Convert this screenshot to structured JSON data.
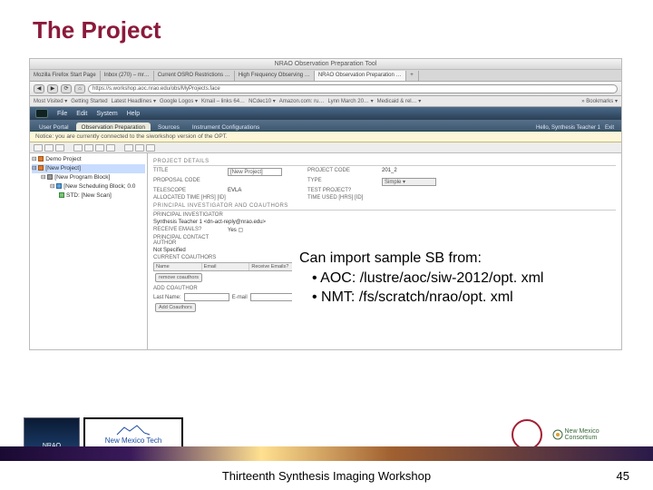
{
  "slide": {
    "title": "The Project",
    "footer_text": "Thirteenth Synthesis Imaging Workshop",
    "page_number": "45"
  },
  "overlay": {
    "heading": "Can import sample SB from:",
    "items": [
      "AOC: /lustre/aoc/siw-2012/opt. xml",
      "NMT: /fs/scratch/nrao/opt. xml"
    ]
  },
  "browser": {
    "window_title": "NRAO Observation Preparation Tool",
    "tabs": [
      "Mozilla Firefox Start Page",
      "Inbox (270) – mr…",
      "Current OSRO Restrictions …",
      "High Frequency Observing …",
      "NRAO Observation Preparation …",
      "+"
    ],
    "active_tab_index": 4,
    "url": "https://s.workshop.aoc.nrao.edu/obs/MyProjects.face",
    "bookmarks": [
      "Most Visited ▾",
      "Getting Started",
      "Latest Headlines ▾",
      "Google Logos ▾",
      "Kmail – links 64…",
      "NCdec10 ▾",
      "Amazon.com: ru…",
      "Lynn March 20… ▾",
      "Medicaid & rel… ▾",
      "» Bookmarks ▾"
    ]
  },
  "opt": {
    "menus": [
      "File",
      "Edit",
      "System",
      "Help"
    ],
    "tabs": [
      "User Portal",
      "Observation Preparation",
      "Sources",
      "Instrument Configurations"
    ],
    "active_tab_index": 1,
    "user_greeting": "Hello, Synthesis Teacher 1",
    "exit": "Exit",
    "notice": "Notice: you are currently connected to the siworkshop version of the OPT."
  },
  "tree": {
    "items": [
      {
        "label": "Demo Project",
        "color": "orange"
      },
      {
        "label": "[New  Project]",
        "color": "orange",
        "selected": true
      },
      {
        "label": "[New Program Block]",
        "color": "grey",
        "indent": 1
      },
      {
        "label": "[New Scheduling Block; 0.0",
        "color": "blue",
        "indent": 2
      },
      {
        "label": "STD: [New Scan]",
        "color": "green",
        "indent": 3
      }
    ]
  },
  "form": {
    "details_header": "PROJECT DETAILS",
    "rows": [
      {
        "label": "TITLE",
        "input": "[New  Project]",
        "label2": "PROJECT CODE",
        "val2": "201_2"
      },
      {
        "label": "PROPOSAL CODE",
        "val": "",
        "label2": "TYPE",
        "input2": "Simple ▾"
      },
      {
        "label": "TELESCOPE",
        "val": "EVLA",
        "label2": "TEST PROJECT?",
        "val2": ""
      },
      {
        "label": "ALLOCATED TIME [HRS] [ID]",
        "val": "",
        "label2": "TIME USED [HRS] [ID]",
        "val2": ""
      }
    ],
    "pi_header": "PRINCIPAL INVESTIGATOR AND COAUTHORS",
    "pi_label": "PRINCIPAL INVESTIGATOR",
    "pi_value": "Synthesis Teacher 1 <dn-act-reply@nrao.edu>",
    "emails_label": "RECEIVE EMAILS?",
    "emails_value": "Yes ▢",
    "contact_label": "PRINCIPAL CONTACT AUTHOR",
    "contact_value": "Not Specified",
    "coauth_label": "CURRENT COAUTHORS",
    "coauth_cols": [
      "Name",
      "Email",
      "Receive Emails?"
    ],
    "remove_btn": "remove coauthors",
    "add_label": "ADD COAUTHOR",
    "lastname": "Last Name:",
    "email": "E-mail",
    "add_btn": "Add Coauthors"
  },
  "logos": {
    "nrao": "NRAO",
    "nmt_top": "New Mexico Tech",
    "nmc": "New Mexico Consortium"
  }
}
